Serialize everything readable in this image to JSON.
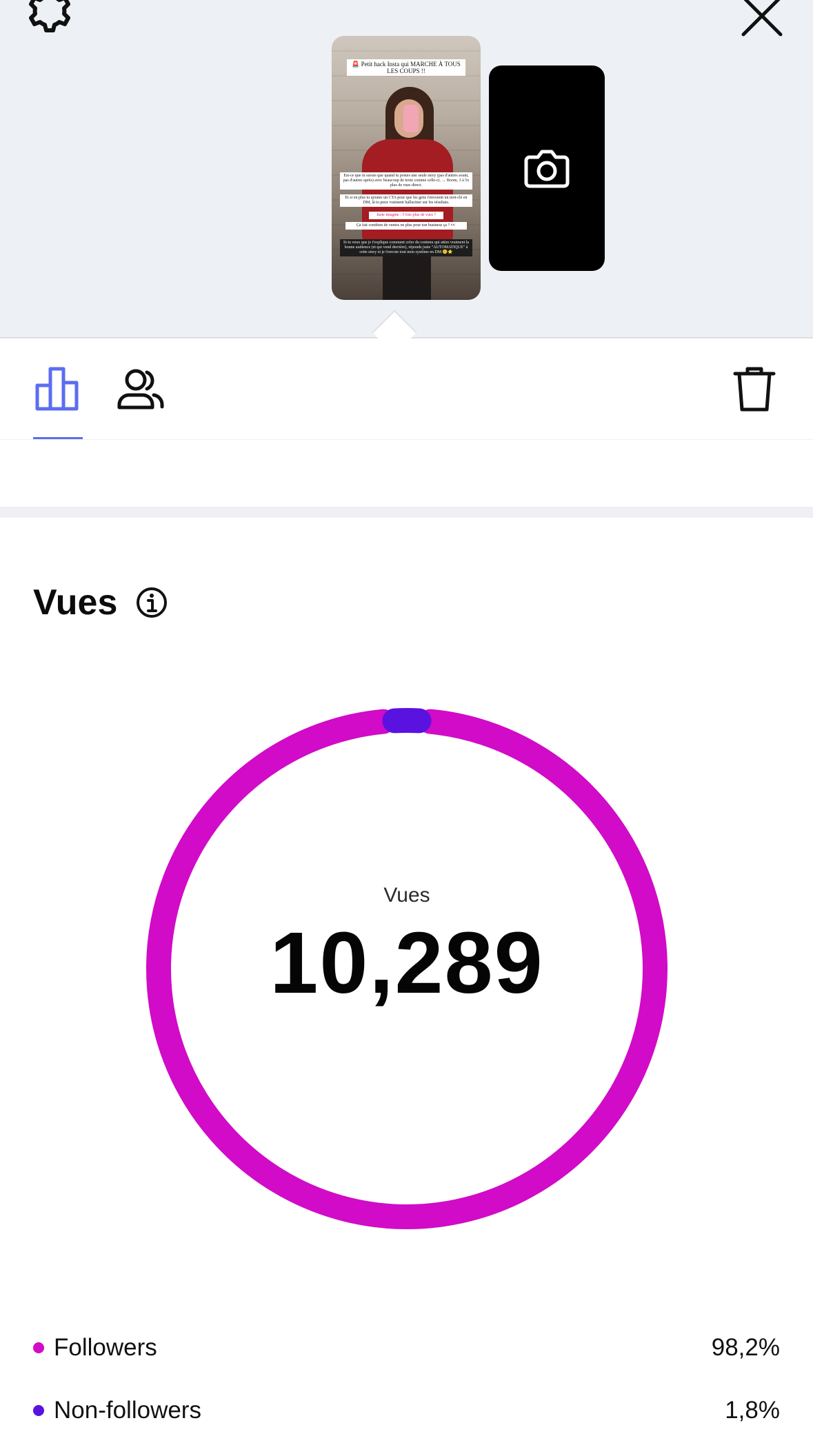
{
  "story": {
    "captions": [
      "🚨 Petit hack Insta qui MARCHE À TOUS LES COUPS !!",
      "Est-ce que tu savais que quand tu postes une seule story (pas d'autres avant, pas d'autres après) avec beaucoup de texte comme celle-ci, → Boom, 3 à 5x plus de vues direct.",
      "Et si en plus tu ajoutes un CTA pour que les gens t'envoient un mot-clé en DM, là tu peux vraiment halluciner sur les résultats.",
      "Juste imagine : 5 fois plus de vues ?",
      "Ça fait combien de ventes en plus pour ton business ça ? 👀",
      "Si tu veux que je t'explique comment créer du contenu qui attire vraiment la bonne audience (et qui vend derrière), réponds juste \"AUTOMATIQUE\" à cette story et je t'envoie tout mon système en DM 🤫⭐"
    ]
  },
  "icons": {
    "settings": "gear-icon",
    "close": "close-icon",
    "camera": "camera-icon",
    "insights": "bar-chart-icon",
    "viewers": "people-icon",
    "delete": "trash-icon",
    "info": "info-icon"
  },
  "colors": {
    "followers": "#d10bc7",
    "non_followers": "#5a12e0",
    "tab_active": "#5b6ef0"
  },
  "views": {
    "title": "Vues",
    "center_label": "Vues",
    "total": "10,289"
  },
  "chart_data": {
    "type": "pie",
    "categories": [
      "Followers",
      "Non-followers"
    ],
    "values": [
      98.2,
      1.8
    ],
    "center_label": "Vues",
    "total": 10289
  },
  "legend": [
    {
      "label": "Followers",
      "value": "98,2%"
    },
    {
      "label": "Non-followers",
      "value": "1,8%"
    }
  ]
}
